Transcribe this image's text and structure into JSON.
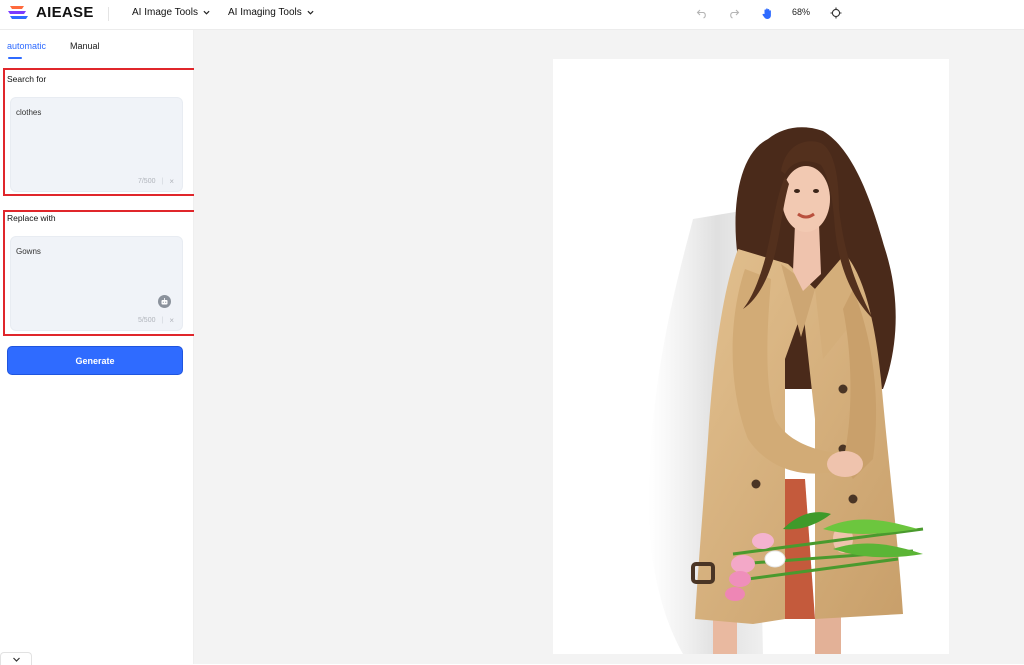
{
  "header": {
    "brand": "AIEASE",
    "nav": [
      {
        "label": "AI Image Tools"
      },
      {
        "label": "AI Imaging Tools"
      }
    ],
    "zoom": "68%"
  },
  "sidebar": {
    "tabs": [
      {
        "label": "automatic",
        "active": true
      },
      {
        "label": "Manual",
        "active": false
      }
    ],
    "search": {
      "label": "Search for",
      "value": "clothes",
      "count": "7/500",
      "clear": "×"
    },
    "replace": {
      "label": "Replace with",
      "value": "Gowns",
      "count": "5/500",
      "clear": "×"
    },
    "generate_label": "Generate"
  },
  "colors": {
    "accent": "#2f6bff",
    "highlight": "#e0262b",
    "coat": "#d9b582"
  }
}
